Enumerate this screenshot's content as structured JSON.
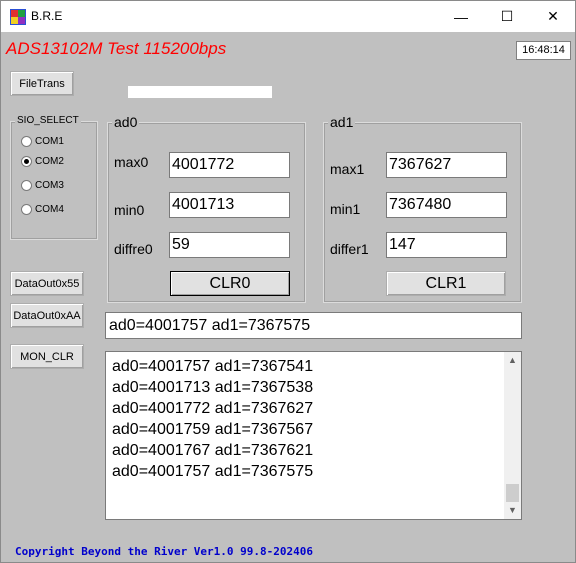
{
  "window": {
    "title": "B.R.E",
    "minimize": "—",
    "maximize": "☐",
    "close": "✕"
  },
  "app_title": "ADS13102M Test 115200bps",
  "clock": "16:48:14",
  "buttons": {
    "filetrans": "FileTrans",
    "dataout55": "DataOut0x55",
    "dataoutaa": "DataOut0xAA",
    "mon_clr": "MON_CLR",
    "clr0": "CLR0",
    "clr1": "CLR1"
  },
  "sio": {
    "title": "SIO_SELECT",
    "options": [
      "COM1",
      "COM2",
      "COM3",
      "COM4"
    ],
    "selected": "COM2"
  },
  "ad0": {
    "title": "ad0",
    "max_label": "max0",
    "max_value": "4001772",
    "min_label": "min0",
    "min_value": "4001713",
    "diff_label": "diffre0",
    "diff_value": "59"
  },
  "ad1": {
    "title": "ad1",
    "max_label": "max1",
    "max_value": "7367627",
    "min_label": "min1",
    "min_value": "7367480",
    "diff_label": "differ1",
    "diff_value": "147"
  },
  "status_line": "ad0=4001757 ad1=7367575",
  "log": [
    "ad0=4001757 ad1=7367541",
    "ad0=4001713 ad1=7367538",
    "ad0=4001772 ad1=7367627",
    "ad0=4001759 ad1=7367567",
    "ad0=4001767 ad1=7367621",
    "ad0=4001757 ad1=7367575"
  ],
  "copyright": "Copyright Beyond the River Ver1.0 99.8-202406",
  "colors": {
    "title_red": "#ff0000",
    "copyright_blue": "#0000cc",
    "background": "#c0c0c0"
  }
}
